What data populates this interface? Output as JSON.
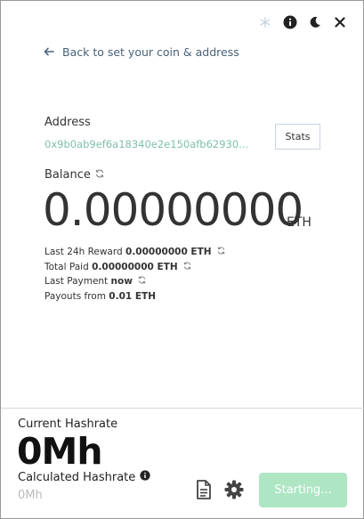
{
  "nav": {
    "back_label": "Back to set your coin & address"
  },
  "address": {
    "label": "Address",
    "value": "0x9b0ab9ef6a18340e2e150afb62930...",
    "stats_button": "Stats"
  },
  "balance": {
    "label": "Balance",
    "value": "0.00000000",
    "unit": "ETH"
  },
  "info": [
    {
      "label": "Last 24h Reward",
      "value": "0.00000000 ETH",
      "refresh": true
    },
    {
      "label": "Total Paid",
      "value": "0.00000000 ETH",
      "refresh": true
    },
    {
      "label": "Last Payment",
      "value": "now",
      "refresh": true
    },
    {
      "label": "Payouts from",
      "value": "0.01 ETH",
      "refresh": false
    }
  ],
  "hashrate": {
    "current_label": "Current Hashrate",
    "current_value": "0Mh",
    "calculated_label": "Calculated Hashrate",
    "calculated_value": "0Mh"
  },
  "actions": {
    "start_label": "Starting..."
  },
  "icons": {
    "top": [
      "snowflake-icon",
      "info-icon",
      "moon-icon",
      "close-icon"
    ],
    "bottom": [
      "document-icon",
      "gear-icon"
    ]
  },
  "colors": {
    "accent_green": "#aee6c4",
    "address_text": "#7ebfae",
    "link_text": "#48627a"
  }
}
